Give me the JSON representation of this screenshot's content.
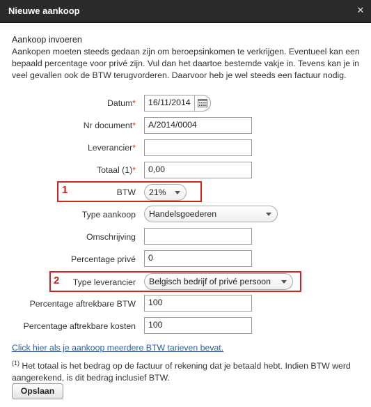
{
  "window": {
    "title": "Nieuwe aankoop",
    "close_symbol": "✕"
  },
  "section": {
    "heading": "Aankoop invoeren",
    "intro": "Aankopen moeten steeds gedaan zijn om beroepsinkomen te verkrijgen. Eventueel kan een bepaald percentage voor privé zijn. Vul dan het daartoe bestemde vakje in. Tevens kan je in veel gevallen ook de BTW terugvorderen. Daarvoor heb je wel steeds een factuur nodig."
  },
  "form": {
    "datum": {
      "label": "Datum",
      "value": "16/11/2014",
      "required": "*"
    },
    "nr_document": {
      "label": "Nr document",
      "value": "A/2014/0004",
      "required": "*"
    },
    "leverancier": {
      "label": "Leverancier",
      "value": "",
      "required": "*"
    },
    "totaal": {
      "label": "Totaal (1)",
      "value": "0,00",
      "required": "*"
    },
    "btw": {
      "label": "BTW",
      "value": "21%"
    },
    "type_aankoop": {
      "label": "Type aankoop",
      "value": "Handelsgoederen"
    },
    "omschrijving": {
      "label": "Omschrijving",
      "value": ""
    },
    "percentage_prive": {
      "label": "Percentage privé",
      "value": "0"
    },
    "type_leverancier": {
      "label": "Type leverancier",
      "value": "Belgisch bedrijf of privé persoon"
    },
    "perc_aftrekbare_btw": {
      "label": "Percentage aftrekbare BTW",
      "value": "100"
    },
    "perc_aftrekbare_kosten": {
      "label": "Percentage aftrekbare kosten",
      "value": "100"
    }
  },
  "annotations": {
    "one": "1",
    "two": "2",
    "color": "#d32020"
  },
  "multi_btw_link": "Click hier als je aankoop meerdere BTW tarieven bevat.",
  "footnote": {
    "marker": "(1)",
    "text": " Het totaal is het bedrag op de factuur of rekening dat je betaald hebt. Indien BTW werd aangerekend, is dit bedrag inclusief BTW."
  },
  "save_label": "Opslaan"
}
